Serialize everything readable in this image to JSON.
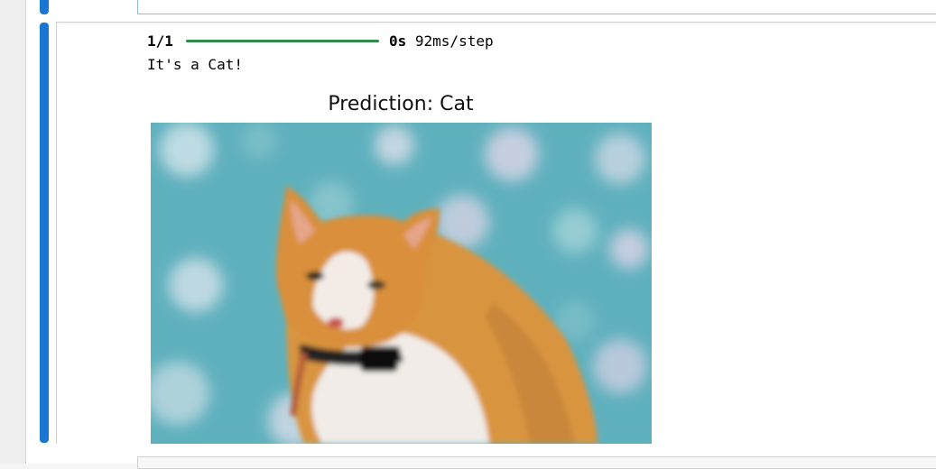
{
  "output": {
    "progress_count": "1/1",
    "progress_fraction": 1.0,
    "progress_time_bold": "0s",
    "progress_time_rest": " 92ms/step",
    "result_text": "It's a Cat!"
  },
  "plot": {
    "title": "Prediction: Cat",
    "image_subject": "orange-and-white-cat-on-blue-bokeh-background"
  },
  "colors": {
    "cell_accent": "#1976d2",
    "progress_bar": "#2e8b4a"
  }
}
